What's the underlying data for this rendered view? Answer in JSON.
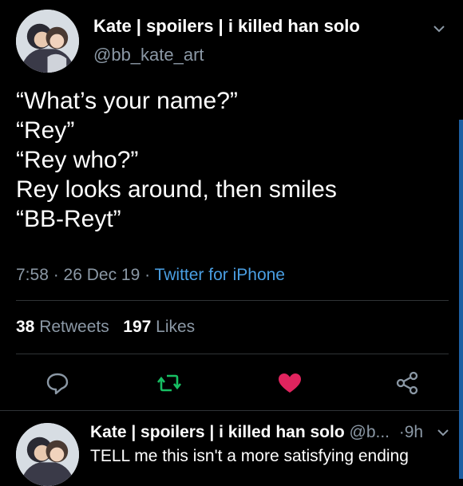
{
  "main_tweet": {
    "author_name": "Kate | spoilers | i killed han solo",
    "handle": "@bb_kate_art",
    "lines": [
      "“What’s your name?”",
      "“Rey”",
      "“Rey who?”",
      "Rey looks around, then smiles",
      "“BB-Reyt”"
    ],
    "time": "7:58",
    "date": "26 Dec 19",
    "source": "Twitter for iPhone",
    "retweet_count": "38",
    "retweet_label": "Retweets",
    "like_count": "197",
    "like_label": "Likes"
  },
  "actions": {
    "reply_icon": "reply-bubble-icon",
    "retweet_icon": "retweet-icon",
    "like_icon": "heart-icon",
    "share_icon": "share-icon"
  },
  "reply_tweet": {
    "author_name": "Kate | spoilers | i killed han solo",
    "handle": "@b...",
    "age": "9h",
    "text": "TELL me this isn't a more satisfying ending"
  },
  "colors": {
    "background": "#000000",
    "muted_text": "#8b98a5",
    "link": "#4a9fe3",
    "retweet_green": "#17bf63",
    "like_pink": "#e0245e",
    "accent_bar": "#1d5fa3"
  }
}
